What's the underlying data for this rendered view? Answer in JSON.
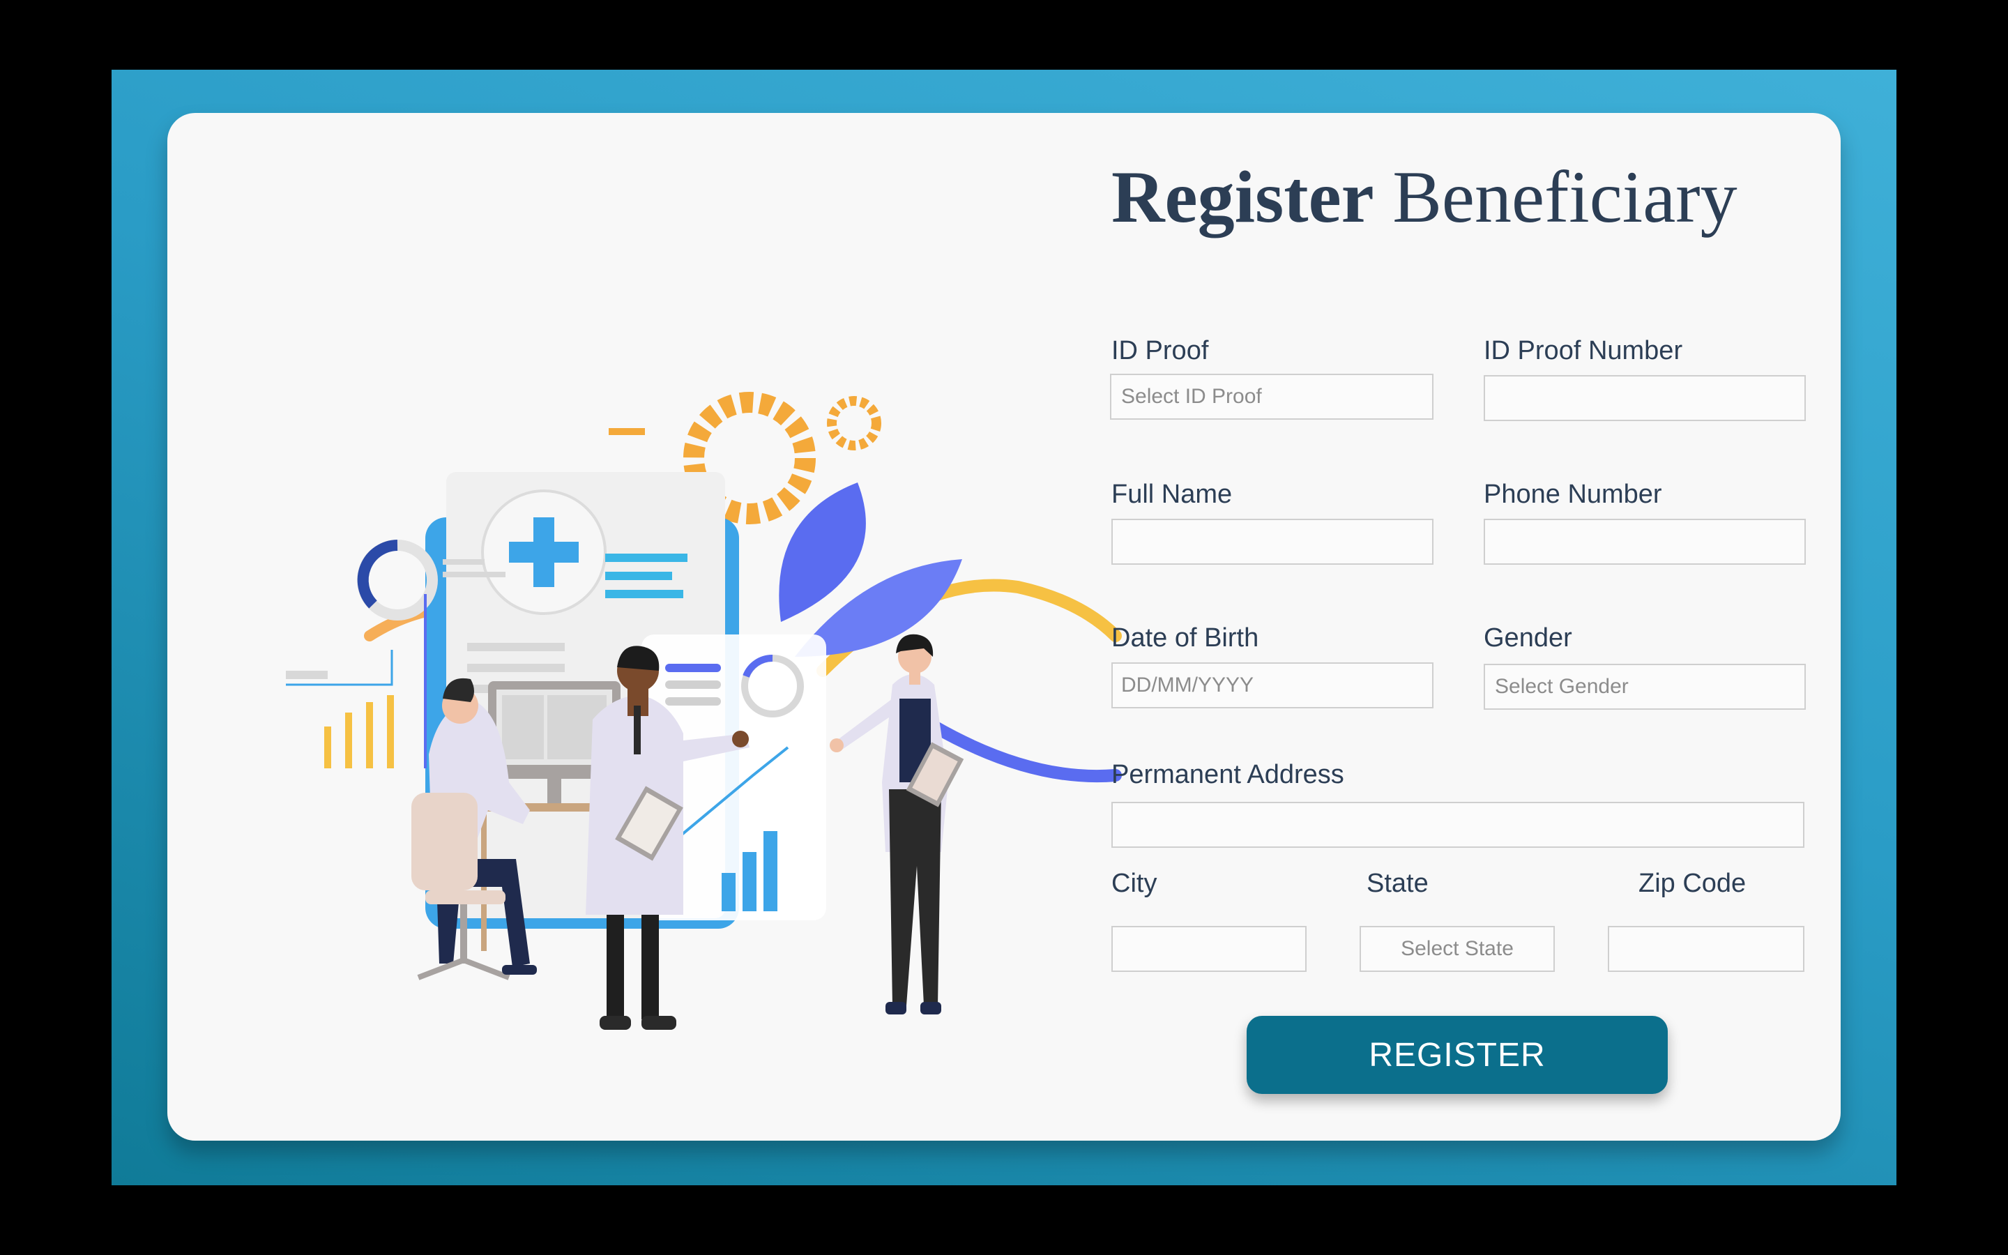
{
  "form": {
    "title_bold": "Register",
    "title_rest": " Beneficiary",
    "id_proof": {
      "label": "ID Proof",
      "placeholder": "Select ID Proof"
    },
    "id_proof_number": {
      "label": "ID Proof Number",
      "value": ""
    },
    "full_name": {
      "label": "Full Name",
      "value": ""
    },
    "phone_number": {
      "label": "Phone Number",
      "value": ""
    },
    "date_of_birth": {
      "label": "Date of Birth",
      "placeholder": "DD/MM/YYYY"
    },
    "gender": {
      "label": "Gender",
      "placeholder": "Select Gender"
    },
    "permanent_address": {
      "label": "Permanent Address",
      "value": ""
    },
    "city": {
      "label": "City",
      "value": ""
    },
    "state": {
      "label": "State",
      "placeholder": "Select State"
    },
    "zip_code": {
      "label": "Zip Code",
      "value": ""
    },
    "register_button": "REGISTER"
  },
  "illustration": {
    "subject": "medical-team-illustration",
    "colors": {
      "blue": "#3da5e8",
      "indigo": "#5a6cf0",
      "yellow": "#f6c143",
      "orange": "#f4a93a",
      "navy": "#1f2a4d"
    }
  },
  "theme": {
    "accent": "#0b6f8c",
    "title_color": "#2c3e55"
  }
}
